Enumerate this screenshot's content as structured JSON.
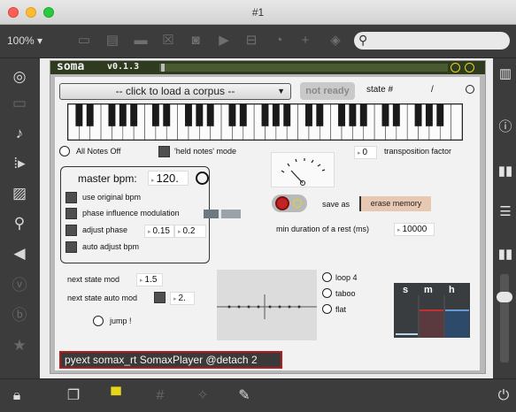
{
  "window": {
    "title": "#1"
  },
  "toolbar": {
    "zoom": "100%",
    "zoom_arrow": "▾",
    "search_placeholder": ""
  },
  "patch": {
    "name": "soma",
    "version": "v0.1.3",
    "corpus_menu": "-- click to load a corpus --",
    "status_button": "not ready",
    "state_label": "state #",
    "state_separator": "/",
    "all_notes_off": "All Notes Off",
    "held_notes_mode": "'held notes' mode",
    "transposition_value": "0",
    "transposition_label": "transposition factor",
    "master_bpm_label": "master bpm:",
    "master_bpm_value": "120.",
    "use_original_bpm": "use original bpm",
    "phase_influence_modulation": "phase influence modulation",
    "adjust_phase": "adjust phase",
    "adjust_phase_value_1": "0.15",
    "adjust_phase_value_2": "0.2",
    "auto_adjust_bpm": "auto adjust bpm",
    "save_as": "save as",
    "erase_memory": "erase memory",
    "min_rest_label": "min duration of a rest (ms)",
    "min_rest_value": "10000",
    "next_state_mod_label": "next state mod",
    "next_state_mod_value": "1.5",
    "next_state_auto_mod_label": "next state auto mod",
    "next_state_auto_mod_value": "2.",
    "jump": "jump !",
    "loop_label": "loop 4",
    "taboo_label": "taboo",
    "flat_label": "flat",
    "smh_headers": [
      "s",
      "m",
      "h"
    ],
    "console_text": "pyext somax_rt SomaxPlayer @detach 2"
  },
  "colors": {
    "header_bg": "#2f3b1f",
    "led_yellow": "#e7d51b",
    "record_red": "#c22323",
    "console_border": "#b21d1d",
    "erase_bg": "#e9c8b3"
  }
}
